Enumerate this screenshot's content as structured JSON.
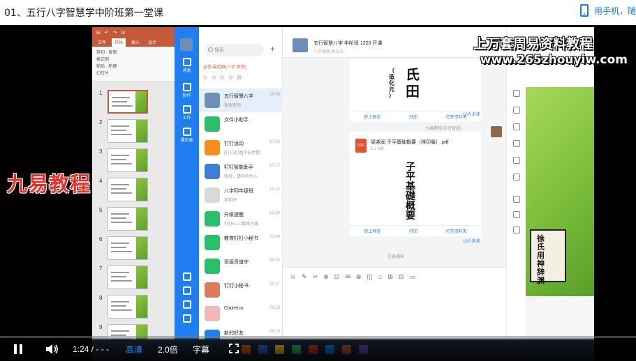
{
  "page": {
    "title": "01、五行八字智慧学中阶班第一堂课",
    "mobile_link": "用手机，随"
  },
  "watermarks": {
    "left": "九易教程",
    "right_line1": "上万套周易资料教程",
    "right_line2": "www.265zhouyiw.com"
  },
  "ppt": {
    "title_bar": [
      "⊟",
      "↶",
      "↷",
      "⊘"
    ],
    "tabs": [
      "文件",
      "开始",
      "插入",
      "设计"
    ],
    "active_tab": "开始",
    "ribbon": [
      "剪切",
      "复制",
      "格式刷",
      "粘贴",
      "新建",
      "幻灯片"
    ],
    "slides": [
      {
        "num": "1",
        "selected": true
      },
      {
        "num": "2",
        "selected": false
      },
      {
        "num": "3",
        "selected": false
      },
      {
        "num": "4",
        "selected": false
      },
      {
        "num": "5",
        "selected": false
      },
      {
        "num": "6",
        "selected": false
      },
      {
        "num": "7",
        "selected": false
      },
      {
        "num": "8",
        "selected": false
      },
      {
        "num": "9",
        "selected": false
      }
    ]
  },
  "dingtalk": {
    "nav": [
      "消息",
      "协作",
      "工作",
      "通讯录"
    ],
    "search_placeholder": "搜索",
    "group_tag": "@我 最近群(八字·师资)",
    "chats": [
      {
        "name": "五行智慧八字",
        "sub": "谢谢老师",
        "time": "19:58",
        "color": "#6b8fb5",
        "active": true
      },
      {
        "name": "文件小助手",
        "sub": "",
        "time": "",
        "color": "#2bbf6b",
        "active": false
      },
      {
        "name": "钉钉运动",
        "sub": "[钉钉运动]今日步数",
        "time": "17:33",
        "color": "#ff8a1f",
        "active": false
      },
      {
        "name": "钉钉智能助手",
        "sub": "你好，请问有什么",
        "time": "12:15",
        "color": "#3b7fd9",
        "active": false
      },
      {
        "name": "八字四年级班",
        "sub": "老师好",
        "time": "12:14",
        "color": "#d9d9d9",
        "active": false
      },
      {
        "name": "升级提醒",
        "sub": "钉钉5.1.0版本升级",
        "time": "12:34",
        "color": "#2bbf6b",
        "active": false
      },
      {
        "name": "教育钉钉小秘书",
        "sub": "",
        "time": "11:49",
        "color": "#2bbf6b",
        "active": false
      },
      {
        "name": "班级员值守",
        "sub": "",
        "time": "09:25",
        "color": "#2bbf6b",
        "active": false
      },
      {
        "name": "钉钉小秘书",
        "sub": "",
        "time": "09:17",
        "color": "#e07a5a",
        "active": false
      },
      {
        "name": "ClaireLiu",
        "sub": "",
        "time": "09:28",
        "color": "#f4b6b6",
        "active": false
      },
      {
        "name": "新的好友",
        "sub": "",
        "time": "09:29",
        "color": "#1f7ff0",
        "active": false
      }
    ],
    "conversation": {
      "title": "五行智慧八字 中阶班 1220 开课",
      "subtitle": "八字课程 群公告",
      "card1_actions": [
        "转上预览",
        "打印",
        "打开资料夹"
      ],
      "card1_read": "10人未读",
      "card1_chars": "氏 田",
      "card1_side": "（ 造 化 元 ）",
      "pdf_name": "梁湘润 子平基础概要（排印版）.pdf",
      "pdf_size": "5.2 MB",
      "pdf_sender": "九易教程(五行智慧)",
      "card2_chars": "子 平 基 礎 概 要",
      "card2_actions": [
        "转上预览",
        "打印",
        "打开资料夹"
      ],
      "card2_read": "10人未读",
      "status": "已读通知"
    }
  },
  "book": {
    "text": "徐氏用神辞渊"
  },
  "player": {
    "time": "1:24 / - - -",
    "quality": "高清",
    "speed": "2.0倍",
    "subtitle": "字幕",
    "progress": 0.0
  },
  "colors": {
    "accent": "#1f8cff",
    "dingtalk_blue": "#1f7ff0",
    "ppt_red": "#c55a3a",
    "slide_green": "#8cc63f"
  }
}
